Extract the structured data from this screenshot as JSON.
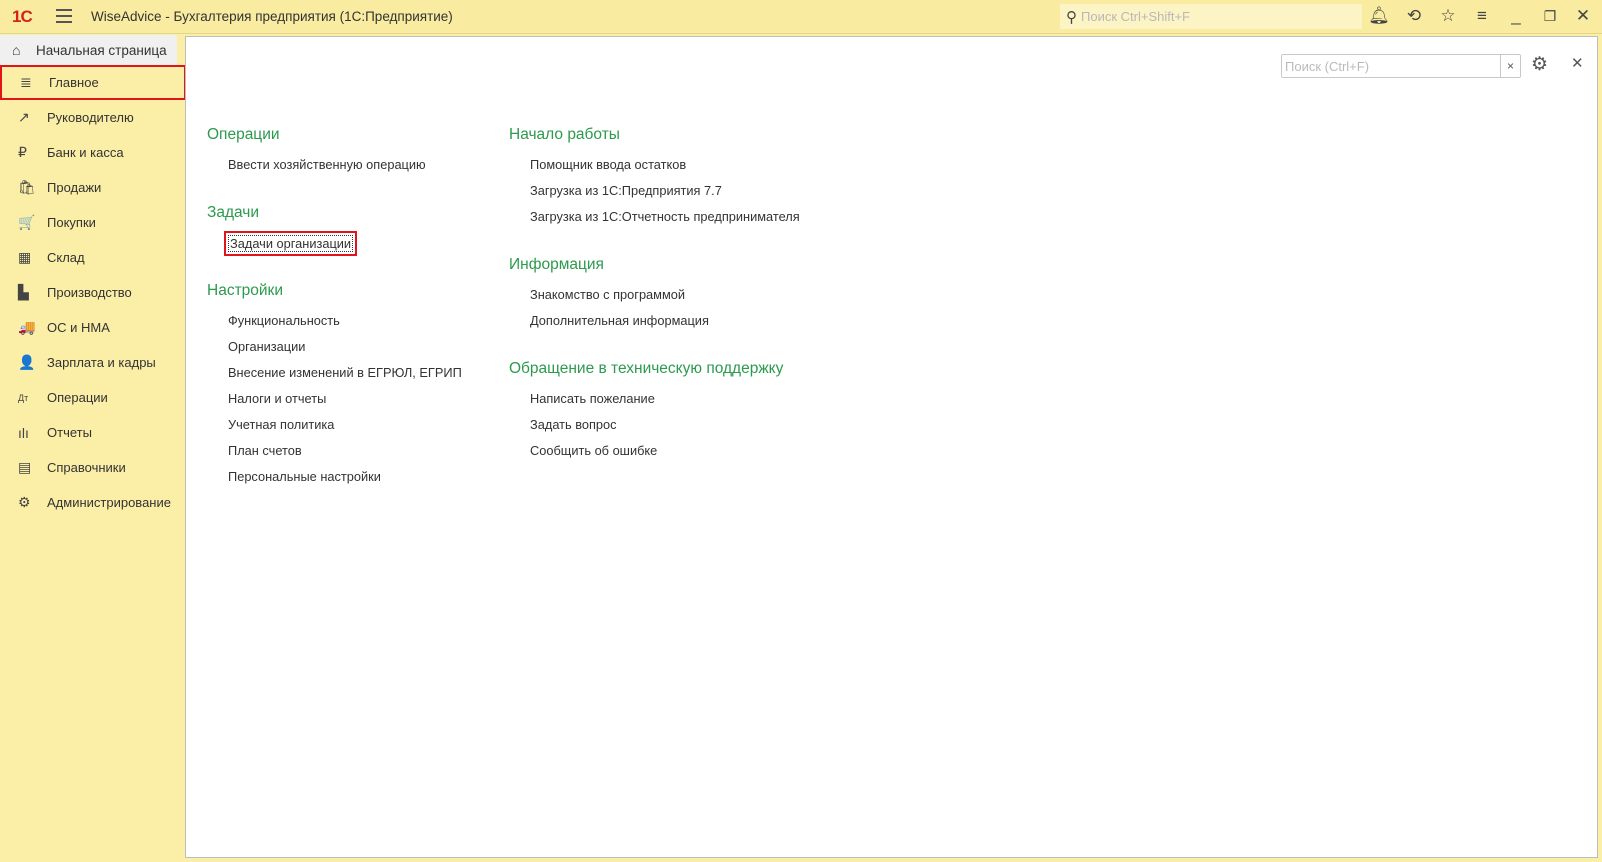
{
  "titlebar": {
    "logo": "1С",
    "title": "WiseAdvice - Бухгалтерия предприятия  (1С:Предприятие)",
    "search_placeholder": "Поиск Ctrl+Shift+F"
  },
  "home": {
    "label": "Начальная страница"
  },
  "sidebar": {
    "items": [
      {
        "label": "Главное",
        "icon": "≣"
      },
      {
        "label": "Руководителю",
        "icon": "↗"
      },
      {
        "label": "Банк и касса",
        "icon": "₽"
      },
      {
        "label": "Продажи",
        "icon": "🛍"
      },
      {
        "label": "Покупки",
        "icon": "🛒"
      },
      {
        "label": "Склад",
        "icon": "▦"
      },
      {
        "label": "Производство",
        "icon": "▙"
      },
      {
        "label": "ОС и НМА",
        "icon": "🚚"
      },
      {
        "label": "Зарплата и кадры",
        "icon": "👤"
      },
      {
        "label": "Операции",
        "icon": "Дт"
      },
      {
        "label": "Отчеты",
        "icon": "ılı"
      },
      {
        "label": "Справочники",
        "icon": "▤"
      },
      {
        "label": "Администрирование",
        "icon": "⚙"
      }
    ]
  },
  "main": {
    "search_placeholder": "Поиск (Ctrl+F)",
    "left": [
      {
        "title": "Операции",
        "links": [
          "Ввести хозяйственную операцию"
        ]
      },
      {
        "title": "Задачи",
        "links": [
          "Задачи организации"
        ]
      },
      {
        "title": "Настройки",
        "links": [
          "Функциональность",
          "Организации",
          "Внесение изменений в ЕГРЮЛ, ЕГРИП",
          "Налоги и отчеты",
          "Учетная политика",
          "План счетов",
          "Персональные настройки"
        ]
      }
    ],
    "right": [
      {
        "title": "Начало работы",
        "links": [
          "Помощник ввода остатков",
          "Загрузка из 1С:Предприятия 7.7",
          "Загрузка из 1С:Отчетность предпринимателя"
        ]
      },
      {
        "title": "Информация",
        "links": [
          "Знакомство с программой",
          "Дополнительная информация"
        ]
      },
      {
        "title": "Обращение в техническую поддержку",
        "links": [
          "Написать пожелание",
          "Задать вопрос",
          "Сообщить об ошибке"
        ]
      }
    ]
  }
}
